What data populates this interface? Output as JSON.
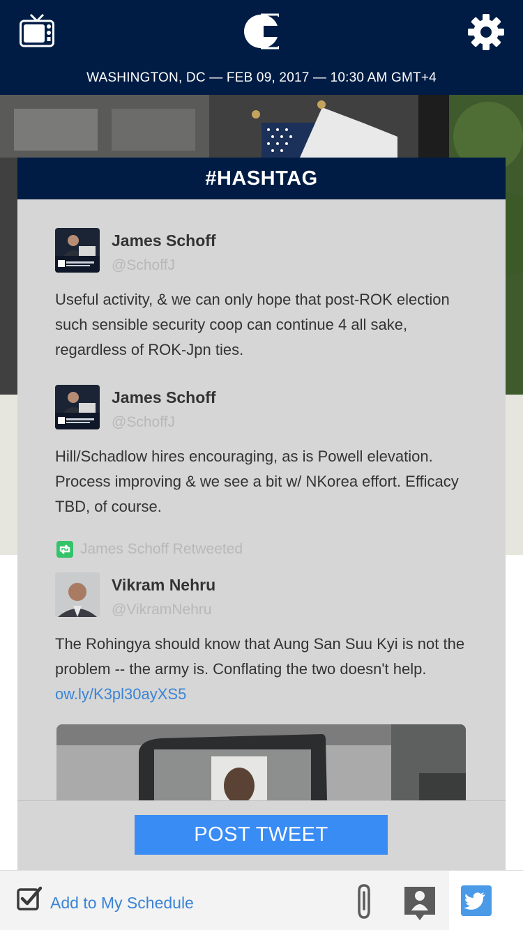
{
  "header": {
    "dateline": "WASHINGTON, DC — FEB 09, 2017 — 10:30 AM GMT+4"
  },
  "panel": {
    "title": "#HASHTAG"
  },
  "tweets": [
    {
      "author": "James Schoff",
      "handle": "@SchoffJ",
      "text": "Useful activity, & we can only hope that post-ROK election such sensible security coop can continue 4 all sake, regardless of ROK-Jpn ties."
    },
    {
      "author": "James Schoff",
      "handle": "@SchoffJ",
      "text": "Hill/Schadlow hires encouraging, as is Powell elevation. Process improving & we see a bit w/ NKorea effort. Efficacy TBD, of course."
    },
    {
      "retweeted_by": "James Schoff Retweeted",
      "author": "Vikram Nehru",
      "handle": "@VikramNehru",
      "text": "The Rohingya should know that Aung San Suu Kyi is not the problem -- the army is.  Conflating the two doesn't help.",
      "link": "ow.ly/K3pl30ayXS5"
    }
  ],
  "post_button": "POST  TWEET",
  "bottom_bar": {
    "schedule_label": "Add to My Schedule"
  },
  "colors": {
    "navy": "#001c44",
    "accent_blue": "#3a8cf5",
    "link_blue": "#3a84d6",
    "retweet_green": "#34c26a"
  },
  "icons": [
    "tv-icon",
    "logo-icon",
    "gear-icon",
    "retweet-icon",
    "checkbox-icon",
    "paperclip-icon",
    "person-icon",
    "twitter-icon"
  ]
}
